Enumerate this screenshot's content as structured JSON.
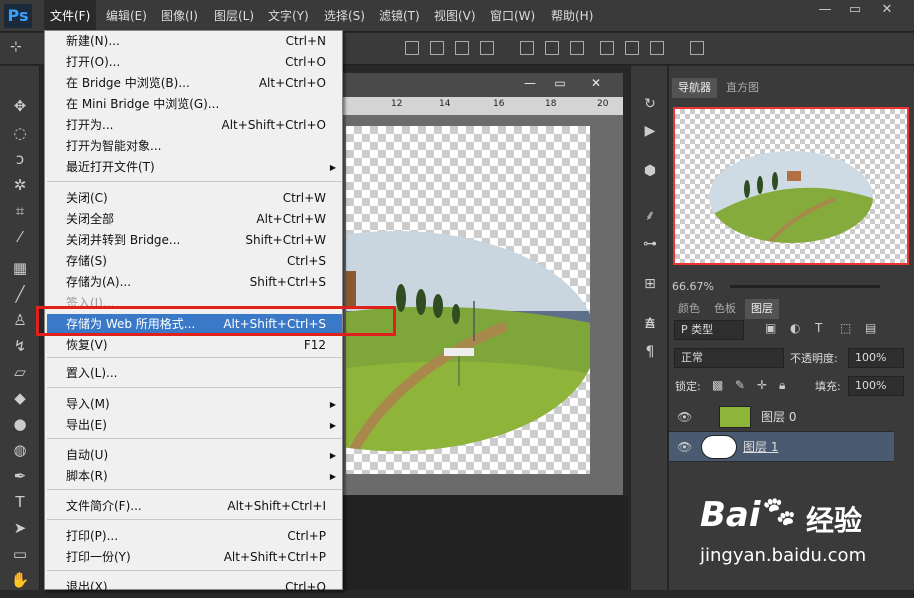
{
  "app": {
    "logo": "Ps"
  },
  "menubar": {
    "items": [
      "文件(F)",
      "编辑(E)",
      "图像(I)",
      "图层(L)",
      "文字(Y)",
      "选择(S)",
      "滤镜(T)",
      "视图(V)",
      "窗口(W)",
      "帮助(H)"
    ]
  },
  "window": {
    "minimize": "—",
    "restore": "▭",
    "close": "✕"
  },
  "ruler": {
    "ticks": [
      "12",
      "14",
      "16",
      "18",
      "20"
    ]
  },
  "file_menu": [
    {
      "label": "新建(N)...",
      "shortcut": "Ctrl+N"
    },
    {
      "label": "打开(O)...",
      "shortcut": "Ctrl+O"
    },
    {
      "label": "在 Bridge 中浏览(B)...",
      "shortcut": "Alt+Ctrl+O"
    },
    {
      "label": "在 Mini Bridge 中浏览(G)...",
      "shortcut": ""
    },
    {
      "label": "打开为...",
      "shortcut": "Alt+Shift+Ctrl+O"
    },
    {
      "label": "打开为智能对象...",
      "shortcut": ""
    },
    {
      "label": "最近打开文件(T)",
      "shortcut": "",
      "submenu": true
    },
    {
      "label": "关闭(C)",
      "shortcut": "Ctrl+W"
    },
    {
      "label": "关闭全部",
      "shortcut": "Alt+Ctrl+W"
    },
    {
      "label": "关闭并转到 Bridge...",
      "shortcut": "Shift+Ctrl+W"
    },
    {
      "label": "存储(S)",
      "shortcut": "Ctrl+S"
    },
    {
      "label": "存储为(A)...",
      "shortcut": "Shift+Ctrl+S"
    },
    {
      "label": "签入(I)...",
      "shortcut": "",
      "disabled": true
    },
    {
      "label": "存储为 Web 所用格式...",
      "shortcut": "Alt+Shift+Ctrl+S",
      "highlighted": true
    },
    {
      "label": "恢复(V)",
      "shortcut": "F12"
    },
    {
      "label": "置入(L)...",
      "shortcut": ""
    },
    {
      "label": "导入(M)",
      "shortcut": "",
      "submenu": true
    },
    {
      "label": "导出(E)",
      "shortcut": "",
      "submenu": true
    },
    {
      "label": "自动(U)",
      "shortcut": "",
      "submenu": true
    },
    {
      "label": "脚本(R)",
      "shortcut": "",
      "submenu": true
    },
    {
      "label": "文件简介(F)...",
      "shortcut": "Alt+Shift+Ctrl+I"
    },
    {
      "label": "打印(P)...",
      "shortcut": "Ctrl+P"
    },
    {
      "label": "打印一份(Y)",
      "shortcut": "Alt+Shift+Ctrl+P"
    },
    {
      "label": "退出(X)",
      "shortcut": "Ctrl+Q"
    }
  ],
  "navigator": {
    "tabs": [
      "导航器",
      "直方图"
    ],
    "zoom": "66.67%"
  },
  "layers_panel": {
    "tabs": [
      "颜色",
      "色板",
      "图层"
    ],
    "filter": "P 类型",
    "blend_mode": "正常",
    "opacity_label": "不透明度:",
    "opacity": "100%",
    "lock_label": "锁定:",
    "fill_label": "填充:",
    "fill": "100%",
    "layers": [
      {
        "name": "图层 0",
        "selected": false
      },
      {
        "name": "图层 1",
        "selected": true
      }
    ]
  },
  "watermark": {
    "brand": "Bai",
    "brand2": "经验",
    "url": "jingyan.baidu.com"
  },
  "colors": {
    "accent": "#3a78c8",
    "highlight_box": "#e0201a"
  }
}
